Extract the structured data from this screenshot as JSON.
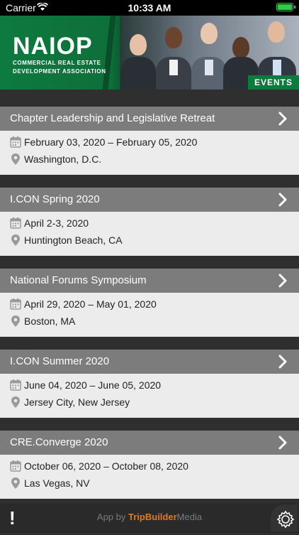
{
  "status_bar": {
    "carrier": "Carrier",
    "time": "10:33 AM"
  },
  "banner": {
    "logo_name": "NAIOP",
    "logo_sub_line1": "COMMERCIAL REAL ESTATE",
    "logo_sub_line2": "DEVELOPMENT ASSOCIATION",
    "tag": "EVENTS",
    "brand_color": "#0d7a3e"
  },
  "events": [
    {
      "title": "Chapter Leadership and Legislative Retreat",
      "date": "February 03, 2020 – February 05, 2020",
      "location": "Washington, D.C."
    },
    {
      "title": "I.CON Spring 2020",
      "date": "April 2-3, 2020",
      "location": "Huntington Beach, CA"
    },
    {
      "title": "National Forums Symposium",
      "date": "April 29, 2020 – May 01, 2020",
      "location": "Boston, MA"
    },
    {
      "title": "I.CON Summer 2020",
      "date": "June 04, 2020 – June 05, 2020",
      "location": "Jersey City, New Jersey"
    },
    {
      "title": "CRE.Converge 2020",
      "date": "October 06, 2020 – October 08, 2020",
      "location": "Las Vegas, NV"
    }
  ],
  "footer": {
    "credit_prefix": "App by",
    "credit_brand": "TripBuilder",
    "credit_suffix": "Media",
    "alert_label": "!"
  }
}
